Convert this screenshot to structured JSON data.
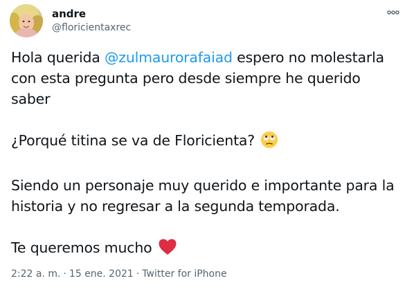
{
  "author": {
    "display_name": "andre",
    "handle": "@floricientaxrec"
  },
  "icons": {
    "more": "more-horizontal-icon",
    "avatar": "avatar-image",
    "emoji_1": "face-with-rolling-eyes-emoji",
    "emoji_2": "red-heart-emoji"
  },
  "tweet": {
    "p1_before": "Hola querida ",
    "p1_mention": "@zulmaurorafaiad",
    "p1_after": " espero no molestarla con esta pregunta pero desde siempre he querido saber",
    "p2": "¿Porqué titina se va de Floricienta?",
    "p3": "Siendo un personaje muy querido e importante para la historia y no regresar a la segunda temporada.",
    "p4": "Te queremos mucho"
  },
  "meta": {
    "time": "2:22 a. m.",
    "sep1": "·",
    "date": "15 ene. 2021",
    "sep2": "·",
    "source": "Twitter for iPhone"
  },
  "colors": {
    "text": "#0f1419",
    "secondary": "#536471",
    "link": "#1d9bf0",
    "heart": "#e0245e"
  }
}
